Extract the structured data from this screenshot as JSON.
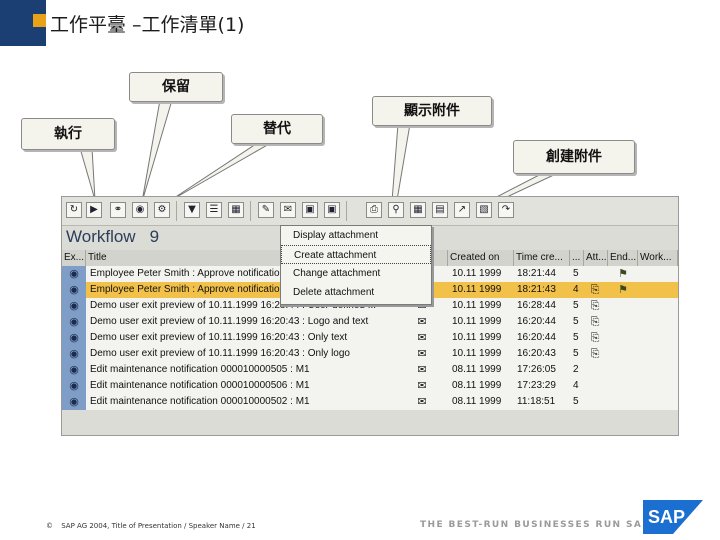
{
  "slide": {
    "title": "工作平臺 –工作清單(1)",
    "callouts": {
      "reserve": "保留",
      "execute": "執行",
      "substitute": "替代",
      "display_attachment": "顯示附件",
      "create_attachment": "創建附件"
    },
    "footer": {
      "copyright_symbol": "©",
      "copyright_text": "SAP AG 2004, Title of Presentation / Speaker Name / 21",
      "tagline": "THE BEST-RUN BUSINESSES RUN SAP",
      "logo_text": "SAP"
    }
  },
  "window": {
    "title": "Workflow",
    "count": "9",
    "toolbar_icons": [
      "refresh-icon",
      "execute-icon",
      "glasses-icon",
      "reserve-icon",
      "substitute-icon",
      "filter-icon",
      "list-icon",
      "save-icon",
      "edit-icon",
      "attachment-menu-icon",
      "document-icon",
      "print-icon",
      "find-icon",
      "layout-icon",
      "export-icon"
    ],
    "columns": [
      "Ex...",
      "Title",
      "s",
      "Created on",
      "Time cre...",
      "...",
      "Att...",
      "End...",
      "Work..."
    ],
    "rows": [
      {
        "title": "Employee Peter Smith : Approve notificatio",
        "created": "10.11 1999",
        "time": "18:21:44",
        "priority": "5",
        "selected": false,
        "flag": true,
        "attach": false
      },
      {
        "title": "Employee Peter Smith : Approve notificatio",
        "created": "10.11 1999",
        "time": "18:21:43",
        "priority": "4",
        "selected": true,
        "flag": true,
        "attach": true
      },
      {
        "title": "Demo user exit preview of 10.11.1999 16:28:44 : User-defined ...",
        "created": "10.11 1999",
        "time": "16:28:44",
        "priority": "5",
        "selected": false,
        "flag": false,
        "attach": true
      },
      {
        "title": "Demo user exit preview of 10.11.1999 16:20:43 : Logo and text",
        "created": "10.11 1999",
        "time": "16:20:44",
        "priority": "5",
        "selected": false,
        "flag": false,
        "attach": true
      },
      {
        "title": "Demo user exit preview of 10.11.1999 16:20:43 : Only text",
        "created": "10.11 1999",
        "time": "16:20:44",
        "priority": "5",
        "selected": false,
        "flag": false,
        "attach": true
      },
      {
        "title": "Demo user exit preview of 10.11.1999 16:20:43 : Only logo",
        "created": "10.11 1999",
        "time": "16:20:43",
        "priority": "5",
        "selected": false,
        "flag": false,
        "attach": true
      },
      {
        "title": "Edit maintenance notification 000010000505 : M1",
        "created": "08.11 1999",
        "time": "17:26:05",
        "priority": "2",
        "selected": false,
        "flag": false,
        "attach": false
      },
      {
        "title": "Edit maintenance notification 000010000506 : M1",
        "created": "08.11 1999",
        "time": "17:23:29",
        "priority": "4",
        "selected": false,
        "flag": false,
        "attach": false
      },
      {
        "title": "Edit maintenance notification 000010000502 : M1",
        "created": "08.11 1999",
        "time": "11:18:51",
        "priority": "5",
        "selected": false,
        "flag": false,
        "attach": false
      }
    ],
    "context_menu": [
      {
        "label": "Display attachment",
        "active": false
      },
      {
        "label": "Create attachment",
        "active": true
      },
      {
        "label": "Change attachment",
        "active": false
      },
      {
        "label": "Delete attachment",
        "active": false
      }
    ]
  },
  "colors": {
    "header_bar": "#1c3f73",
    "header_accent": "#e8a21a",
    "selected_row": "#f2c14a",
    "sap_blue": "#1a6fd1"
  }
}
